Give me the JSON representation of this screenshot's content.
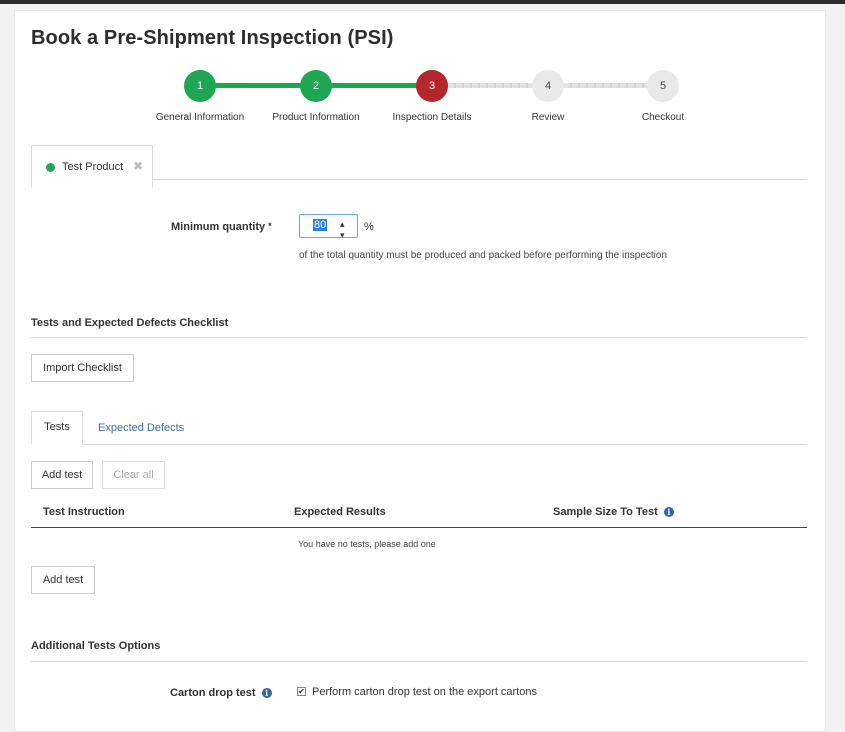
{
  "page": {
    "title": "Book a Pre-Shipment Inspection (PSI)"
  },
  "stepper": {
    "steps": [
      {
        "number": "1",
        "label": "General Information",
        "state": "done"
      },
      {
        "number": "2",
        "label": "Product Information",
        "state": "done"
      },
      {
        "number": "3",
        "label": "Inspection Details",
        "state": "active"
      },
      {
        "number": "4",
        "label": "Review",
        "state": "todo"
      },
      {
        "number": "5",
        "label": "Checkout",
        "state": "todo"
      }
    ],
    "colors": {
      "done": "#1fa653",
      "active": "#b3262b",
      "todo": "#e9e9e9"
    }
  },
  "product_tab": {
    "label": "Test Product",
    "close_glyph": "✖",
    "status_color": "#1fa653"
  },
  "minimum_quantity": {
    "label": "Minimum quantity",
    "required_mark": "*",
    "value": "80",
    "unit": "%",
    "help_text": "of the total quantity must be produced and packed before performing the inspection"
  },
  "checklist": {
    "section_title": "Tests and Expected Defects Checklist",
    "import_button": "Import Checklist"
  },
  "tabs": [
    {
      "label": "Tests",
      "active": true
    },
    {
      "label": "Expected Defects",
      "active": false
    }
  ],
  "tests": {
    "add_button": "Add test",
    "clear_button": "Clear all",
    "columns": [
      "Test Instruction",
      "Expected Results",
      "Sample Size To Test"
    ],
    "empty_message": "You have no tests, please add one",
    "add_button_bottom": "Add test"
  },
  "additional": {
    "section_title": "Additional Tests Options",
    "carton_label": "Carton drop test",
    "carton_checked": true,
    "carton_option": "Perform carton drop test on the export cartons"
  },
  "icons": {
    "info": "info-icon",
    "spinner": "number-spinner-icon",
    "check": "checkmark-icon",
    "close": "close-icon"
  }
}
